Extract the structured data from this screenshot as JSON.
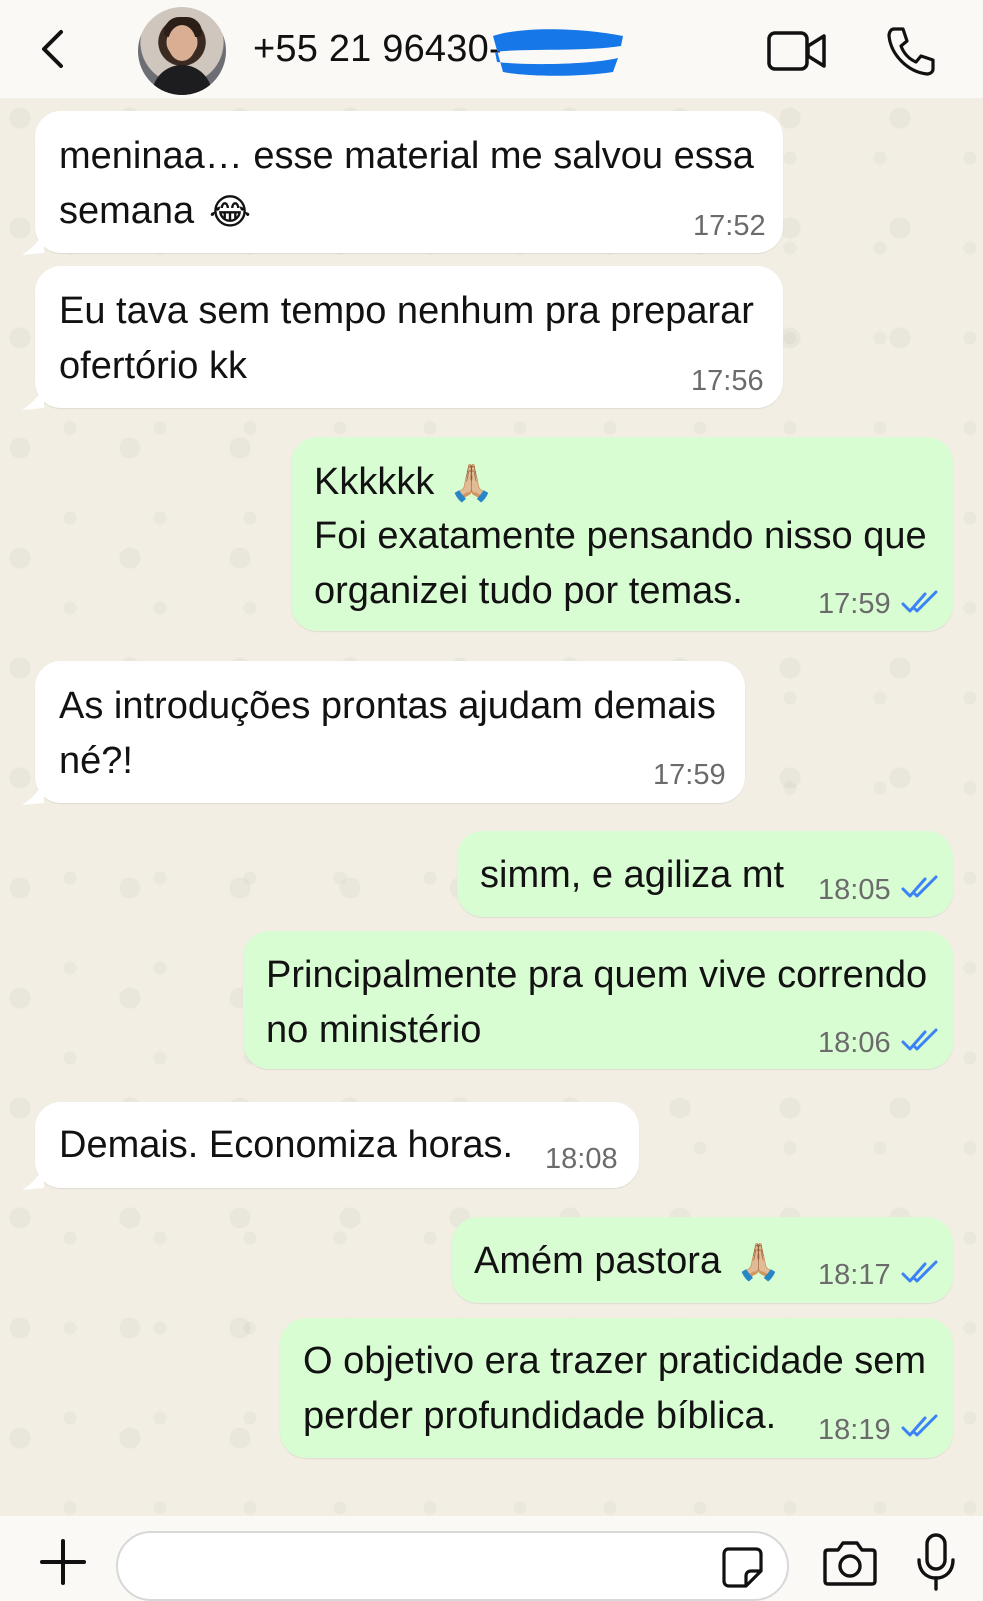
{
  "header": {
    "contact_name": "+55 21 96430-",
    "back_icon": "chevron-left-icon",
    "video_icon": "video-camera-icon",
    "call_icon": "phone-icon"
  },
  "messages": [
    {
      "direction": "in",
      "lines": [
        "meninaa… esse material me salvou essa",
        "semana"
      ],
      "emoji": "😂",
      "time": "17:52"
    },
    {
      "direction": "in",
      "lines": [
        "Eu tava sem tempo nenhum pra preparar",
        "ofertório kk"
      ],
      "time": "17:56"
    },
    {
      "direction": "out",
      "lines": [
        "Kkkkkk",
        "Foi exatamente pensando nisso que",
        "organizei tudo por temas."
      ],
      "emoji": "🙏🏼",
      "time": "17:59",
      "status": "read"
    },
    {
      "direction": "in",
      "lines": [
        "As introduções prontas ajudam demais",
        "né?!"
      ],
      "time": "17:59"
    },
    {
      "direction": "out",
      "lines": [
        "simm, e agiliza mt"
      ],
      "time": "18:05",
      "status": "read"
    },
    {
      "direction": "out",
      "lines": [
        "Principalmente pra quem vive correndo",
        "no ministério"
      ],
      "time": "18:06",
      "status": "read"
    },
    {
      "direction": "in",
      "lines": [
        "Demais. Economiza horas."
      ],
      "time": "18:08"
    },
    {
      "direction": "out",
      "lines": [
        "Amém pastora"
      ],
      "emoji": "🙏🏼",
      "time": "18:17",
      "status": "read"
    },
    {
      "direction": "out",
      "lines": [
        "O objetivo era trazer praticidade sem",
        "perder profundidade bíblica."
      ],
      "time": "18:19",
      "status": "read"
    }
  ],
  "footer": {
    "input_value": "",
    "plus_icon": "plus-icon",
    "sticker_icon": "sticker-icon",
    "camera_icon": "camera-icon",
    "mic_icon": "microphone-icon"
  },
  "colors": {
    "incoming_bubble": "#ffffff",
    "outgoing_bubble": "#d9fdd3",
    "read_ticks": "#3b82f6",
    "redaction": "#1677e8"
  }
}
